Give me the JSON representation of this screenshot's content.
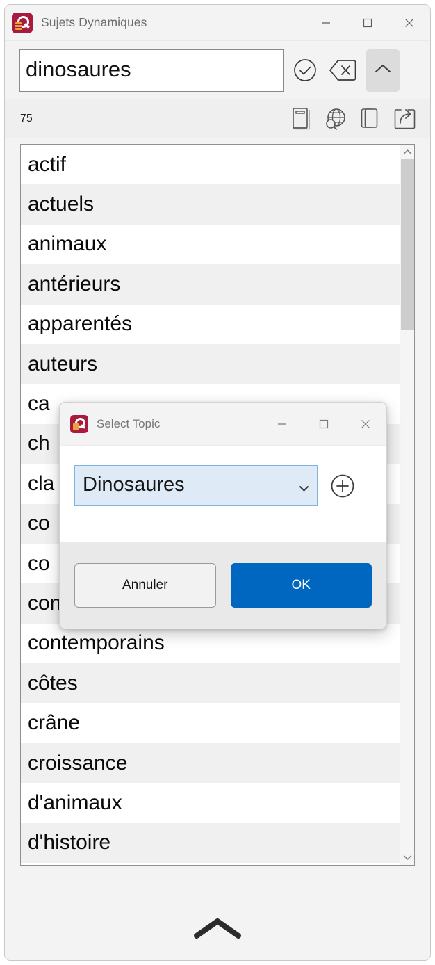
{
  "window": {
    "title": "Sujets Dynamiques",
    "icon": "app-logo-icon",
    "controls": {
      "minimize": "—",
      "maximize": "☐",
      "close": "✕"
    }
  },
  "search": {
    "value": "dinosaures",
    "placeholder": "",
    "confirm_icon": "check-circle-icon",
    "clear_icon": "backspace-clear-icon",
    "collapse_icon": "chevron-up-icon"
  },
  "toolbar": {
    "count": "75",
    "icons": [
      {
        "name": "dictionary-icon"
      },
      {
        "name": "globe-search-icon"
      },
      {
        "name": "copy-icon"
      },
      {
        "name": "share-export-icon"
      }
    ]
  },
  "list": {
    "items": [
      "actif",
      "actuels",
      "animaux",
      "antérieurs",
      "apparentés",
      "auteurs",
      "ca",
      "ch",
      "cla",
      "co",
      "co",
      "connus",
      "contemporains",
      "côtes",
      "crâne",
      "croissance",
      "d'animaux",
      "d'histoire"
    ],
    "scrollbar": {
      "up_arrow": "chevron-up-icon",
      "down_arrow": "chevron-down-icon"
    }
  },
  "bottom": {
    "collapse_icon": "chevron-up-large-icon"
  },
  "dialog": {
    "title": "Select Topic",
    "icon": "app-logo-icon",
    "controls": {
      "minimize": "—",
      "maximize": "☐",
      "close": "✕"
    },
    "topic_select": {
      "value": "Dinosaures",
      "dropdown_icon": "chevron-down-icon"
    },
    "add_button_icon": "plus-circle-icon",
    "cancel_label": "Annuler",
    "ok_label": "OK"
  },
  "colors": {
    "accent": "#0067c0",
    "app_icon": "#a81b3f",
    "select_bg": "#deebf7",
    "select_border": "#7eb4e2",
    "window_bg": "#f3f3f3"
  }
}
